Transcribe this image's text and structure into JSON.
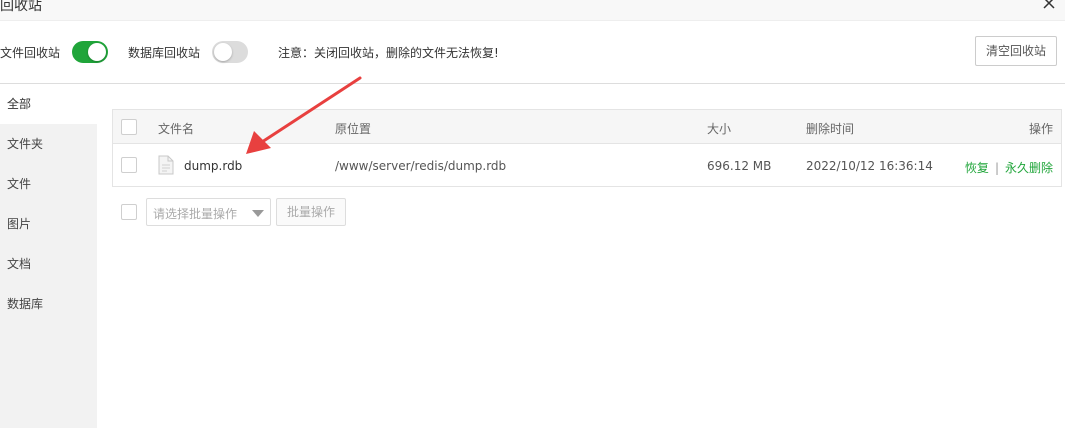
{
  "window": {
    "title": "回收站"
  },
  "toolbar": {
    "file_recycle_label": "文件回收站",
    "file_recycle_on": true,
    "db_recycle_label": "数据库回收站",
    "db_recycle_on": false,
    "notice": "注意：关闭回收站，删除的文件无法恢复!",
    "clear_label": "清空回收站"
  },
  "sidebar": {
    "items": [
      {
        "label": "全部",
        "active": true
      },
      {
        "label": "文件夹"
      },
      {
        "label": "文件"
      },
      {
        "label": "图片"
      },
      {
        "label": "文档"
      },
      {
        "label": "数据库"
      }
    ]
  },
  "table": {
    "headers": [
      "文件名",
      "原位置",
      "大小",
      "删除时间",
      "操作"
    ],
    "rows": [
      {
        "name": "dump.rdb",
        "location": "/www/server/redis/dump.rdb",
        "size": "696.12 MB",
        "time": "2022/10/12 16:36:14",
        "restore": "恢复",
        "separator": "|",
        "delete": "永久删除"
      }
    ]
  },
  "batch": {
    "placeholder": "请选择批量操作",
    "button": "批量操作"
  },
  "colors": {
    "accent": "#20a53a",
    "annotation_arrow": "#e8403f"
  }
}
